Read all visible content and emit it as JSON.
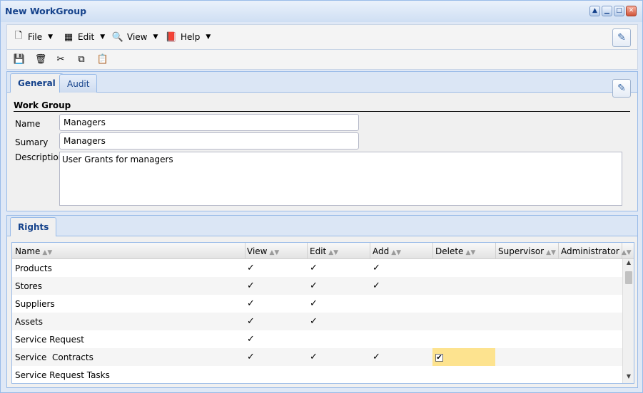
{
  "window": {
    "title": "New WorkGroup"
  },
  "menu": {
    "items": [
      {
        "label": "File",
        "icon": "file-icon"
      },
      {
        "label": "Edit",
        "icon": "edit-icon"
      },
      {
        "label": "View",
        "icon": "view-icon"
      },
      {
        "label": "Help",
        "icon": "help-icon"
      }
    ]
  },
  "toolbar": {
    "icons": [
      "save-icon",
      "delete-icon",
      "cut-icon",
      "copy-icon",
      "paste-icon"
    ]
  },
  "general_panel": {
    "tabs": [
      {
        "label": "General",
        "active": true
      },
      {
        "label": "Audit",
        "active": false
      }
    ],
    "section_title": "Work Group",
    "fields": {
      "name": {
        "label": "Name",
        "value": "Managers"
      },
      "summary": {
        "label": "Sumary",
        "value": "Managers"
      },
      "description": {
        "label": "Description",
        "value": "User Grants for managers"
      }
    }
  },
  "rights_panel": {
    "tab_label": "Rights",
    "columns": [
      "Name",
      "View",
      "Edit",
      "Add",
      "Delete",
      "Supervisor",
      "Administrator"
    ],
    "rows": [
      {
        "name": "Products",
        "view": "✓",
        "edit": "✓",
        "add": "✓",
        "delete": "",
        "supervisor": "",
        "administrator": ""
      },
      {
        "name": "Stores",
        "view": "✓",
        "edit": "✓",
        "add": "✓",
        "delete": "",
        "supervisor": "",
        "administrator": ""
      },
      {
        "name": "Suppliers",
        "view": "✓",
        "edit": "✓",
        "add": "",
        "delete": "",
        "supervisor": "",
        "administrator": ""
      },
      {
        "name": "Assets",
        "view": "✓",
        "edit": "✓",
        "add": "",
        "delete": "",
        "supervisor": "",
        "administrator": ""
      },
      {
        "name": "Service Request",
        "view": "✓",
        "edit": "",
        "add": "",
        "delete": "",
        "supervisor": "",
        "administrator": ""
      },
      {
        "name": "Service  Contracts",
        "view": "✓",
        "edit": "✓",
        "add": "✓",
        "delete": "✔",
        "supervisor": "",
        "administrator": ""
      },
      {
        "name": "Service Request Tasks",
        "view": "",
        "edit": "",
        "add": "",
        "delete": "",
        "supervisor": "",
        "administrator": ""
      }
    ],
    "editing": {
      "row": 5,
      "column": "delete"
    }
  },
  "colors": {
    "header": "#15428b",
    "border": "#99bbe8",
    "edit_highlight": "#fde38f"
  }
}
